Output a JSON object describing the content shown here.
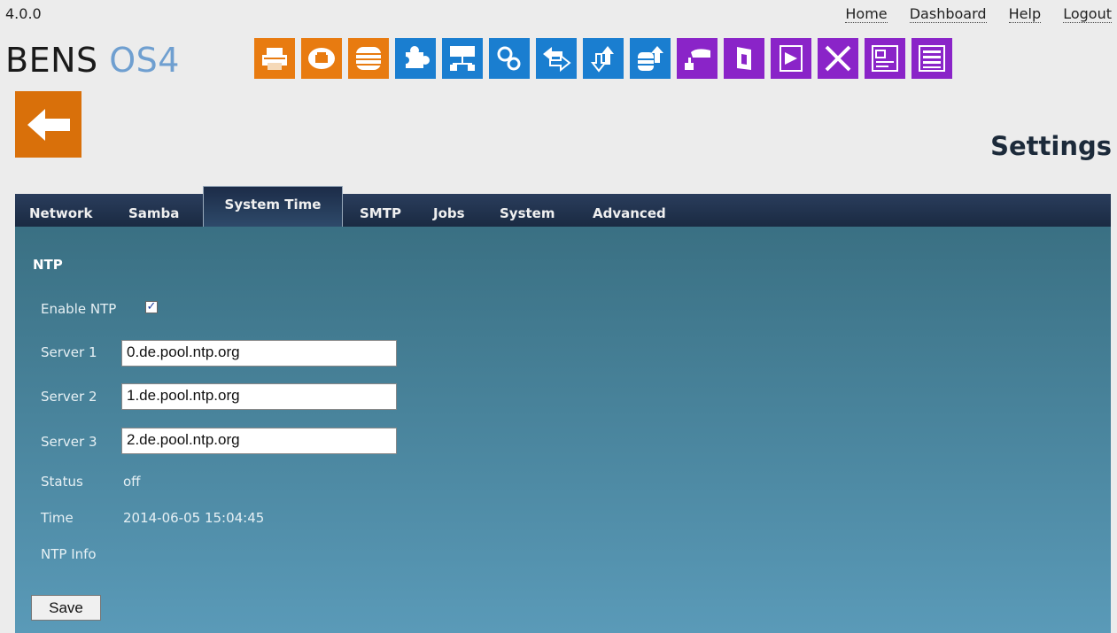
{
  "version": "4.0.0",
  "toplinks": {
    "home": "Home",
    "dashboard": "Dashboard",
    "help": "Help",
    "logout": "Logout"
  },
  "brand": {
    "part1": "BENS",
    "part2": "OS4"
  },
  "icons": [
    {
      "name": "printer-icon",
      "color": "#e87b10"
    },
    {
      "name": "cloud-printer-icon",
      "color": "#e87b10"
    },
    {
      "name": "database-icon",
      "color": "#e87b10"
    },
    {
      "name": "puzzle-icon",
      "color": "#1a7ed0"
    },
    {
      "name": "network-icon",
      "color": "#1a7ed0"
    },
    {
      "name": "gears-icon",
      "color": "#1a7ed0"
    },
    {
      "name": "transfer-icon",
      "color": "#1a7ed0"
    },
    {
      "name": "up-down-arrows-icon",
      "color": "#1a7ed0"
    },
    {
      "name": "database-upload-icon",
      "color": "#1a7ed0"
    },
    {
      "name": "scanner-icon",
      "color": "#8a24c8"
    },
    {
      "name": "door-icon",
      "color": "#8a24c8"
    },
    {
      "name": "script-file-icon",
      "color": "#8a24c8"
    },
    {
      "name": "tools-icon",
      "color": "#8a24c8"
    },
    {
      "name": "form-icon",
      "color": "#8a24c8"
    },
    {
      "name": "list-icon",
      "color": "#8a24c8"
    }
  ],
  "page_title": "Settings",
  "tabs": [
    "Network",
    "Samba",
    "System Time",
    "SMTP",
    "Jobs",
    "System",
    "Advanced"
  ],
  "active_tab": "System Time",
  "form": {
    "section_title": "NTP",
    "enable_label": "Enable NTP",
    "enable_checked": true,
    "server1_label": "Server 1",
    "server1_value": "0.de.pool.ntp.org",
    "server2_label": "Server 2",
    "server2_value": "1.de.pool.ntp.org",
    "server3_label": "Server 3",
    "server3_value": "2.de.pool.ntp.org",
    "status_label": "Status",
    "status_value": "off",
    "time_label": "Time",
    "time_value": "2014-06-05 15:04:45",
    "ntp_info_label": "NTP Info",
    "save_label": "Save"
  }
}
